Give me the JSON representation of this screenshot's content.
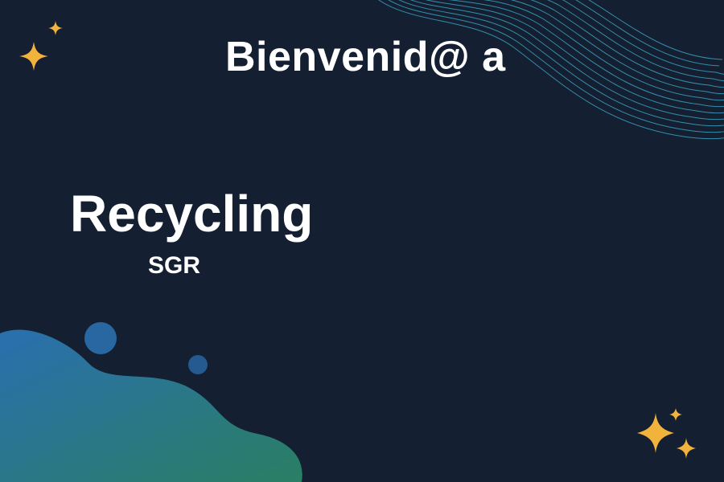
{
  "page": {
    "welcome_text": "Bienvenid@ a",
    "brand_name": "Recycling",
    "brand_subtitle": "SGR"
  },
  "colors": {
    "background": "#141f31",
    "text": "#ffffff",
    "sparkle": "#f2b33d",
    "wave_line": "#39a2c0",
    "blob_start": "#2a6faf",
    "blob_end": "#2a7f63"
  },
  "decorations": {
    "wave_icon": "wave-lines-icon",
    "blob_icon": "gradient-blob-icon",
    "sparkle_icon": "four-point-star-icon"
  }
}
